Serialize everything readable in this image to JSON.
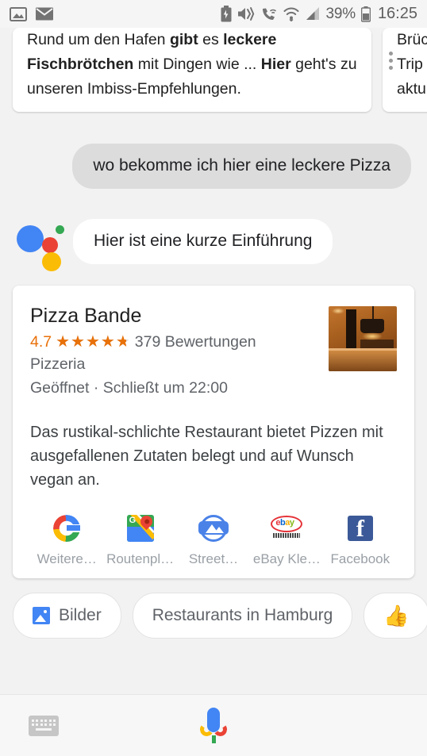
{
  "status_bar": {
    "icons": [
      "photo-icon",
      "mail-icon",
      "battery-saver-icon",
      "vibrate-icon",
      "wifi-calling-icon",
      "wifi-icon",
      "cellular-signal-icon",
      "battery-icon"
    ],
    "battery_percent": "39%",
    "clock": "16:25"
  },
  "top_cards": {
    "primary": {
      "seg1": "Rund um den Hafen ",
      "bold1": "gibt",
      "seg2": " es ",
      "bold2": "leckere Fischbrötchen",
      "seg3": " mit Dingen wie ... ",
      "bold3": "Hier",
      "seg4": " geht's zu unseren Imbiss-Empfehlungen."
    },
    "secondary": {
      "line1": "Brüc",
      "line2": "Trip",
      "line3": "aktu"
    }
  },
  "conversation": {
    "user_query": "wo bekomme ich hier eine leckere Pizza",
    "assistant_reply": "Hier ist eine kurze Einführung"
  },
  "place_card": {
    "title": "Pizza Bande",
    "rating_score": "4.7",
    "rating_value": 4.7,
    "review_count": "379 Bewertungen",
    "category": "Pizzeria",
    "hours": "Geöffnet · Schließt um 22:00",
    "description": "Das rustikal-schlichte Restaurant bietet Pizzen mit ausgefallenen Zutaten belegt und auf Wunsch vegan an.",
    "accent_color": "#e8710a",
    "actions": [
      {
        "label": "Weitere…",
        "icon": "google-g-icon"
      },
      {
        "label": "Routenpl…",
        "icon": "google-maps-icon"
      },
      {
        "label": "Street…",
        "icon": "street-view-icon"
      },
      {
        "label": "eBay Kle…",
        "icon": "ebay-kleinanzeigen-icon"
      },
      {
        "label": "Facebook",
        "icon": "facebook-icon"
      }
    ]
  },
  "suggestion_chips": [
    {
      "label": "Bilder",
      "icon": "image-icon"
    },
    {
      "label": "Restaurants in Hamburg",
      "icon": ""
    },
    {
      "label": "👍",
      "icon": "thumbs-up-icon"
    }
  ],
  "bottom_bar": {
    "keyboard_label": "keyboard-icon",
    "mic_label": "microphone-icon"
  }
}
